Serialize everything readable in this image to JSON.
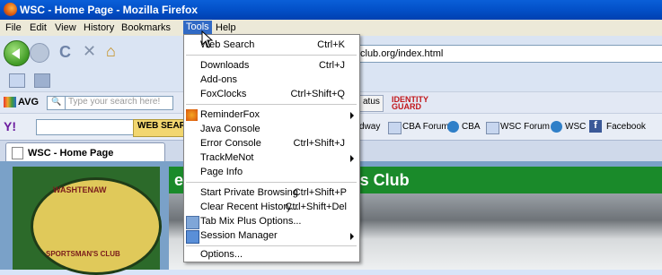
{
  "window": {
    "title": "WSC - Home Page - Mozilla Firefox"
  },
  "menubar": {
    "items": [
      "File",
      "Edit",
      "View",
      "History",
      "Bookmarks",
      "Tools",
      "Help"
    ]
  },
  "navbar": {
    "url_visible": "club.org/index.html"
  },
  "avg": {
    "label": "AVG",
    "search_placeholder": "Type your search here!",
    "status": "atus",
    "idprotect": "IDENTITY GUARD"
  },
  "yahoo": {
    "web_search": "WEB SEARC",
    "links": [
      "dway",
      "CBA Forum",
      "CBA",
      "WSC Forum",
      "WSC",
      "Facebook"
    ]
  },
  "tab": {
    "title": "WSC - Home Page"
  },
  "page": {
    "heading_partial": "e Washtenaw Sportman's Club",
    "logo_top": "WASHTENAW",
    "logo_bottom": "SPORTSMAN'S CLUB"
  },
  "tools_menu": {
    "items": [
      {
        "label": "Web Search",
        "shortcut": "Ctrl+K"
      },
      {
        "label": "Downloads",
        "shortcut": "Ctrl+J"
      },
      {
        "label": "Add-ons",
        "shortcut": ""
      },
      {
        "label": "FoxClocks",
        "shortcut": "Ctrl+Shift+Q"
      },
      {
        "label": "ReminderFox",
        "shortcut": "",
        "submenu": true
      },
      {
        "label": "Java Console",
        "shortcut": ""
      },
      {
        "label": "Error Console",
        "shortcut": "Ctrl+Shift+J"
      },
      {
        "label": "TrackMeNot",
        "shortcut": "",
        "submenu": true
      },
      {
        "label": "Page Info",
        "shortcut": ""
      },
      {
        "label": "Start Private Browsing",
        "shortcut": "Ctrl+Shift+P"
      },
      {
        "label": "Clear Recent History...",
        "shortcut": "Ctrl+Shift+Del"
      },
      {
        "label": "Tab Mix Plus Options...",
        "shortcut": ""
      },
      {
        "label": "Session Manager",
        "shortcut": "",
        "submenu": true
      },
      {
        "label": "Options...",
        "shortcut": ""
      }
    ]
  }
}
